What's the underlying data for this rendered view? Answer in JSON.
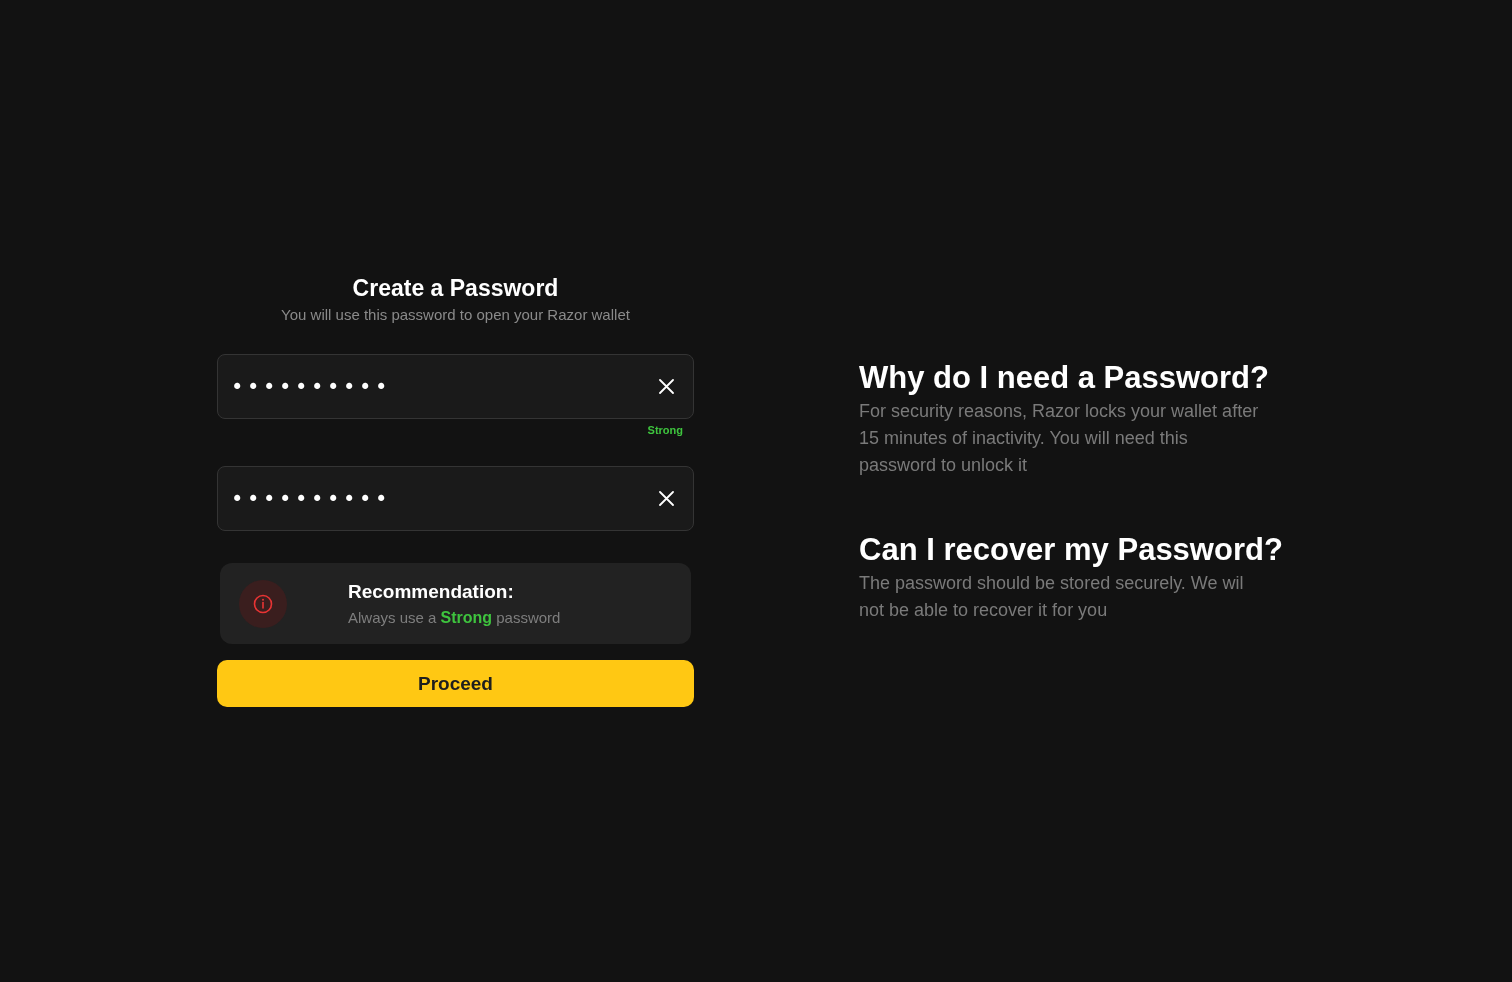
{
  "form": {
    "title": "Create a Password",
    "subtitle": "You will use this password to open your Razor wallet",
    "fields": [
      {
        "value": "••••••••••",
        "strength": "Strong"
      },
      {
        "value": "••••••••••"
      }
    ],
    "recommendation": {
      "title": "Recommendation:",
      "text": "Always use a **Strong** password"
    },
    "proceed_button": "Proceed"
  },
  "faq": [
    {
      "question": "Why do I need a Password?",
      "answer": "For security reasons, Razor locks your wallet after 15 minutes of inactivity. You will need this password to unlock it"
    },
    {
      "question": "Can I recover my Password?",
      "answer": "The password should be stored securely. We wil not be able to recover it for you"
    }
  ]
}
